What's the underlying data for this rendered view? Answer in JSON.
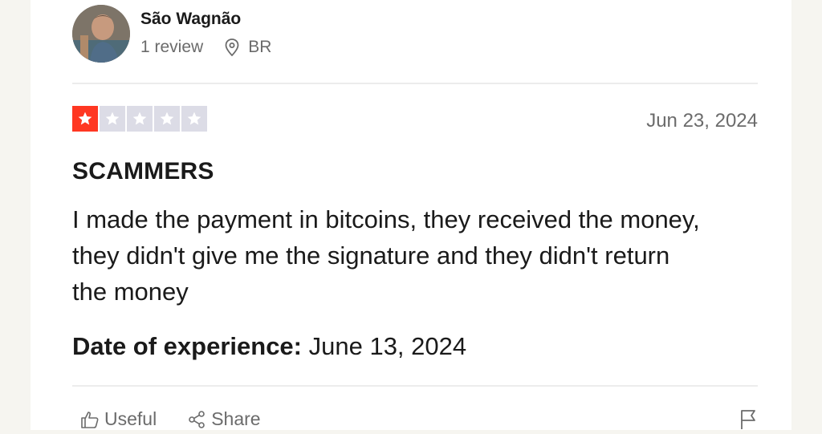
{
  "reviewer": {
    "name": "São Wagnão",
    "review_count": "1 review",
    "country": "BR"
  },
  "review": {
    "rating": 1,
    "max_rating": 5,
    "date": "Jun 23, 2024",
    "title": "SCAMMERS",
    "body": "I made the payment in bitcoins, they received the money, they didn't give me the signature and they didn't return the money",
    "experience_label": "Date of experience:",
    "experience_date": " June 13, 2024"
  },
  "actions": {
    "useful_label": "Useful",
    "share_label": "Share"
  },
  "colors": {
    "star_filled": "#ff3722",
    "star_empty": "#dcdce6"
  },
  "icons": [
    "location-pin-icon",
    "star-icon",
    "thumbs-up-icon",
    "share-icon",
    "flag-icon"
  ]
}
